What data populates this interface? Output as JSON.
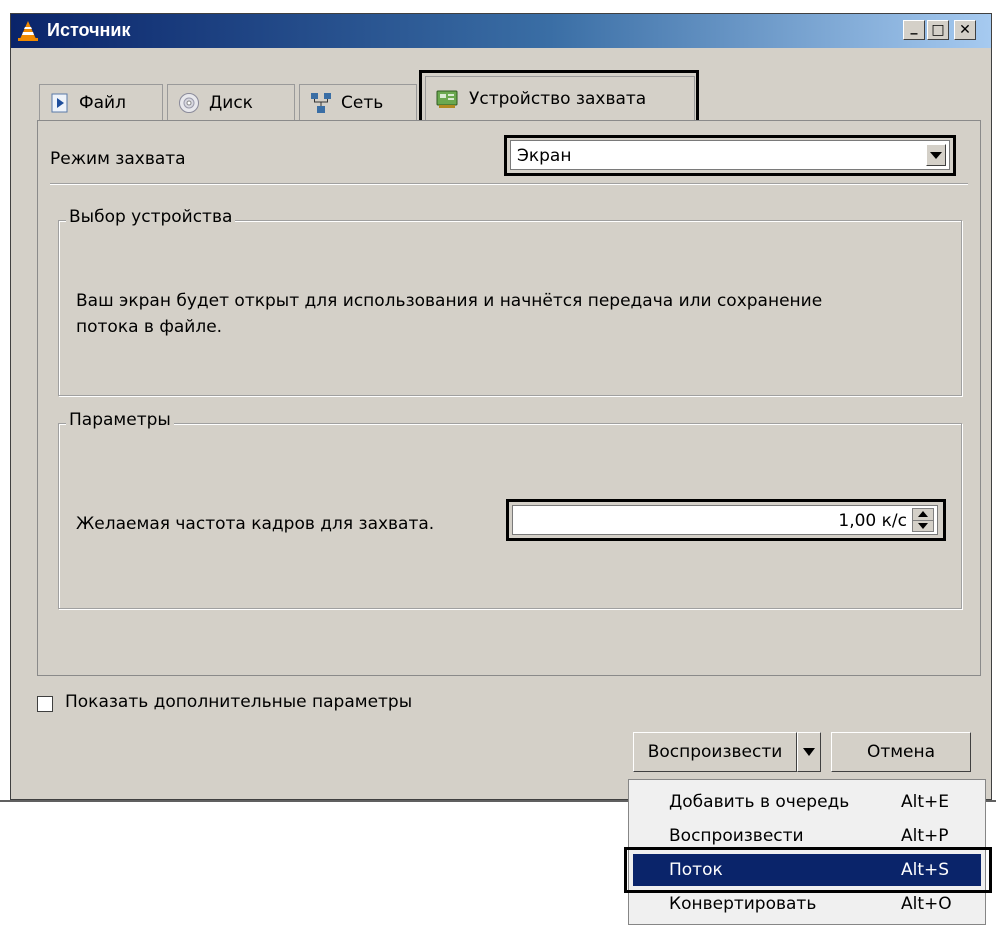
{
  "window": {
    "title": "Источник",
    "minimize": "_",
    "maximize": "□",
    "close": "✕"
  },
  "tabs": [
    {
      "label": "Файл",
      "icon": "file-play-icon"
    },
    {
      "label": "Диск",
      "icon": "disc-icon"
    },
    {
      "label": "Сеть",
      "icon": "network-icon"
    },
    {
      "label": "Устройство захвата",
      "icon": "capture-card-icon",
      "active": true
    }
  ],
  "capture_mode": {
    "label": "Режим захвата",
    "value": "Экран"
  },
  "device_group": {
    "legend": "Выбор устройства",
    "description_line1": "Ваш экран будет открыт для использования и начнётся передача или сохранение",
    "description_line2": "потока в файле."
  },
  "params_group": {
    "legend": "Параметры",
    "fps_label": "Желаемая частота кадров для захвата.",
    "fps_value": "1,00 к/с"
  },
  "advanced": {
    "label": "Показать дополнительные параметры",
    "checked": false
  },
  "buttons": {
    "play": "Воспроизвести",
    "cancel": "Отмена"
  },
  "dropdown_menu": [
    {
      "label": "Добавить в очередь",
      "shortcut": "Alt+E"
    },
    {
      "label": "Воспроизвести",
      "shortcut": "Alt+P"
    },
    {
      "label": "Поток",
      "shortcut": "Alt+S",
      "selected": true
    },
    {
      "label": "Конвертировать",
      "shortcut": "Alt+O"
    }
  ],
  "colors": {
    "title_gradient_start": "#0a246a",
    "title_gradient_end": "#a6caf0",
    "dialog_bg": "#d4d0c8",
    "highlight": "#0a246a",
    "vlc_orange": "#f08a00"
  }
}
